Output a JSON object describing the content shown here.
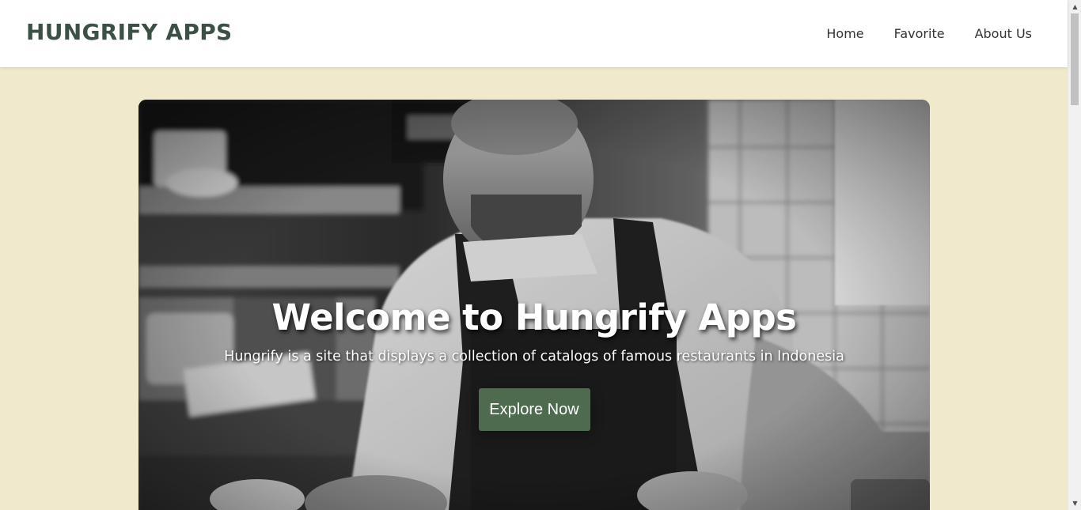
{
  "header": {
    "logo": "HUNGRIFY APPS",
    "nav": [
      {
        "label": "Home"
      },
      {
        "label": "Favorite"
      },
      {
        "label": "About Us"
      }
    ]
  },
  "hero": {
    "title": "Welcome to Hungrify Apps",
    "subtitle": "Hungrify is a site that displays a collection of catalogs of famous restaurants in Indonesia",
    "cta_label": "Explore Now",
    "image_icon": "chef-photo"
  },
  "colors": {
    "page_background": "#f1e9cc",
    "header_background": "#ffffff",
    "logo_color": "#3b5146",
    "cta_background": "#4e6b50",
    "nav_text": "#333333"
  },
  "scrollbar": {
    "up_icon": "scroll-up-arrow-icon",
    "down_icon": "scroll-down-arrow-icon"
  }
}
